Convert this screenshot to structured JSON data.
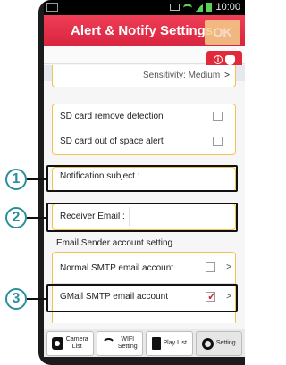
{
  "status_bar": {
    "time": "10:00"
  },
  "header": {
    "title": "Alert & Notify Settings",
    "ok_label": "OK"
  },
  "rows": {
    "sensitivity": "Sensitivity: Medium",
    "sd_remove": "SD card remove detection",
    "sd_space": "SD card out of space alert",
    "notification_subject": "Notification subject :",
    "receiver_email": "Receiver Email :",
    "sender_section": "Email Sender account setting",
    "normal_smtp": "Normal SMTP email account",
    "gmail_smtp": "GMail SMTP email account"
  },
  "chevron": ">",
  "checked_mark": "✓",
  "tabs": {
    "camera_list": [
      "Camera",
      "List"
    ],
    "wifi_setting": [
      "WIFI",
      "Setting"
    ],
    "play_list": "Play List",
    "setting": "Setting"
  },
  "callouts": [
    "1",
    "2",
    "3"
  ],
  "colors": {
    "title_bar": "#e0304a",
    "card_border": "#f2c24e",
    "callout": "#2b8f9b"
  }
}
